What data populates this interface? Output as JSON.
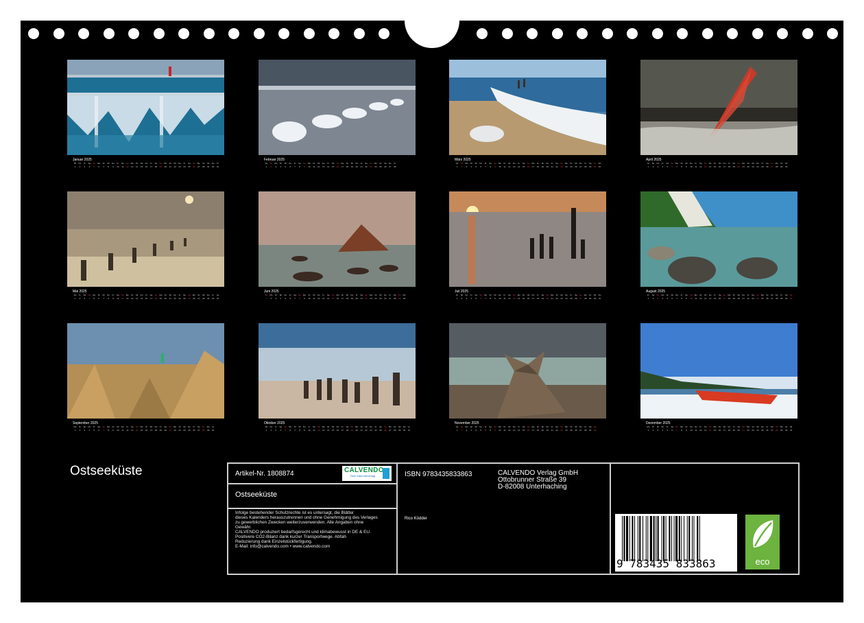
{
  "year": "2025",
  "months": [
    {
      "name": "Januar",
      "start": 2,
      "days": 31
    },
    {
      "name": "Februar",
      "start": 5,
      "days": 28
    },
    {
      "name": "März",
      "start": 5,
      "days": 31
    },
    {
      "name": "April",
      "start": 1,
      "days": 30
    },
    {
      "name": "Mai",
      "start": 3,
      "days": 31
    },
    {
      "name": "Juni",
      "start": 6,
      "days": 30
    },
    {
      "name": "Juli",
      "start": 1,
      "days": 31
    },
    {
      "name": "August",
      "start": 4,
      "days": 31
    },
    {
      "name": "September",
      "start": 0,
      "days": 30
    },
    {
      "name": "Oktober",
      "start": 2,
      "days": 31
    },
    {
      "name": "November",
      "start": 5,
      "days": 30
    },
    {
      "name": "Dezember",
      "start": 0,
      "days": 31
    }
  ],
  "weekday_abbrev": [
    "Mo",
    "Di",
    "Mi",
    "Do",
    "Fr",
    "Sa",
    "So"
  ],
  "title": "Ostseeküste",
  "info": {
    "article": "Artikel-Nr. 1808874",
    "logo_brand": "CALVENDO",
    "logo_tagline": "Dein Kalenderverlag",
    "product_title": "Ostseeküste",
    "legal_lines": [
      "Infolge bestehender Schutzrechte ist es untersagt, die Blätter",
      "dieses Kalenders herauszutrennen und ohne Genehmigung des Verlages",
      "zu gewerblichen Zwecken weiterzuverwenden. Alle Angaben ohne",
      "Gewähr.",
      "CALVENDO produziert bedarfsgerecht und klimabewusst in DE & EU.",
      "Positivere CO2-Bilanz dank kurzer Transportwege. Abfall-",
      "Reduzierung dank Einzelstückfertigung.",
      "E-Mail: info@calvendo.com • www.calvendo.com"
    ],
    "isbn": "ISBN 9783435833863",
    "author": "Rico Ködder",
    "publisher_lines": [
      "CALVENDO Verlag GmbH",
      "Ottobrunner Straße 39",
      "D-82008 Unterhaching"
    ],
    "barcode_digits": "9  783435  833863",
    "eco_label": "eco"
  },
  "colors": {
    "background": "#000000",
    "sunday": "#e03a3a",
    "eco_green": "#6cb33f",
    "logo_green": "#0a8a3c"
  }
}
